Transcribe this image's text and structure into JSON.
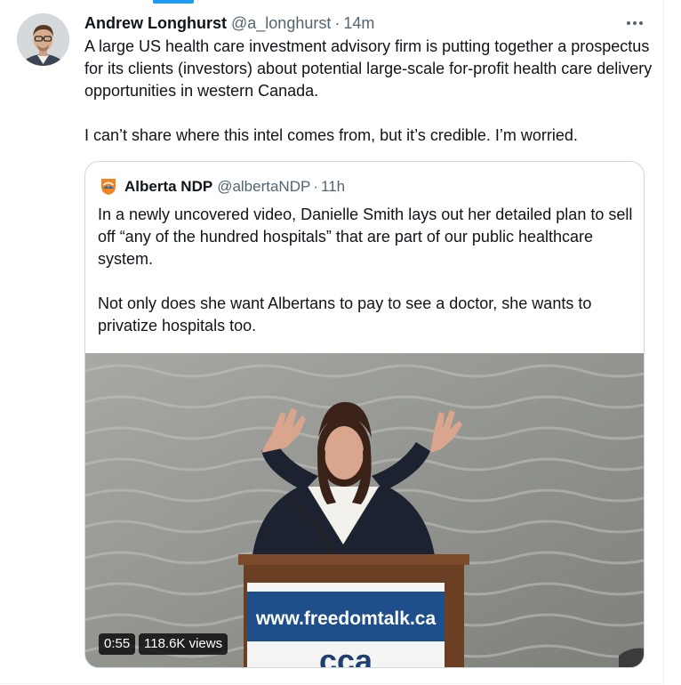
{
  "tweet": {
    "author": {
      "name": "Andrew Longhurst",
      "handle": "@a_longhurst",
      "time": "14m"
    },
    "separator": "·",
    "more_icon": "more-dots-icon",
    "paragraphs": [
      "A large US health care investment advisory firm is putting together a prospectus for its clients (investors) about potential large-scale for-profit health care delivery opportunities in western Canada.",
      "I can’t share where this intel comes from, but it’s credible. I’m worried."
    ]
  },
  "quote": {
    "author": {
      "name": "Alberta NDP",
      "handle": "@albertaNDP",
      "time": "11h",
      "logo_icon": "alberta-ndp-logo-icon"
    },
    "separator": "·",
    "paragraphs": [
      "In a newly uncovered video, Danielle Smith lays out her detailed plan to sell off “any of the hundred hospitals” that are part of our public healthcare system.",
      "Not only does she want Albertans to pay to see a doctor, she wants to privatize hospitals too."
    ],
    "video": {
      "duration": "0:55",
      "views": "118.6K views",
      "podium_sign_text": "www.freedomtalk.ca",
      "podium_logo_text": "cca"
    }
  },
  "colors": {
    "text_primary": "#0f1419",
    "text_secondary": "#536471",
    "accent": "#1d9bf0",
    "border": "#cfd9de",
    "divider": "#eff3f4"
  }
}
